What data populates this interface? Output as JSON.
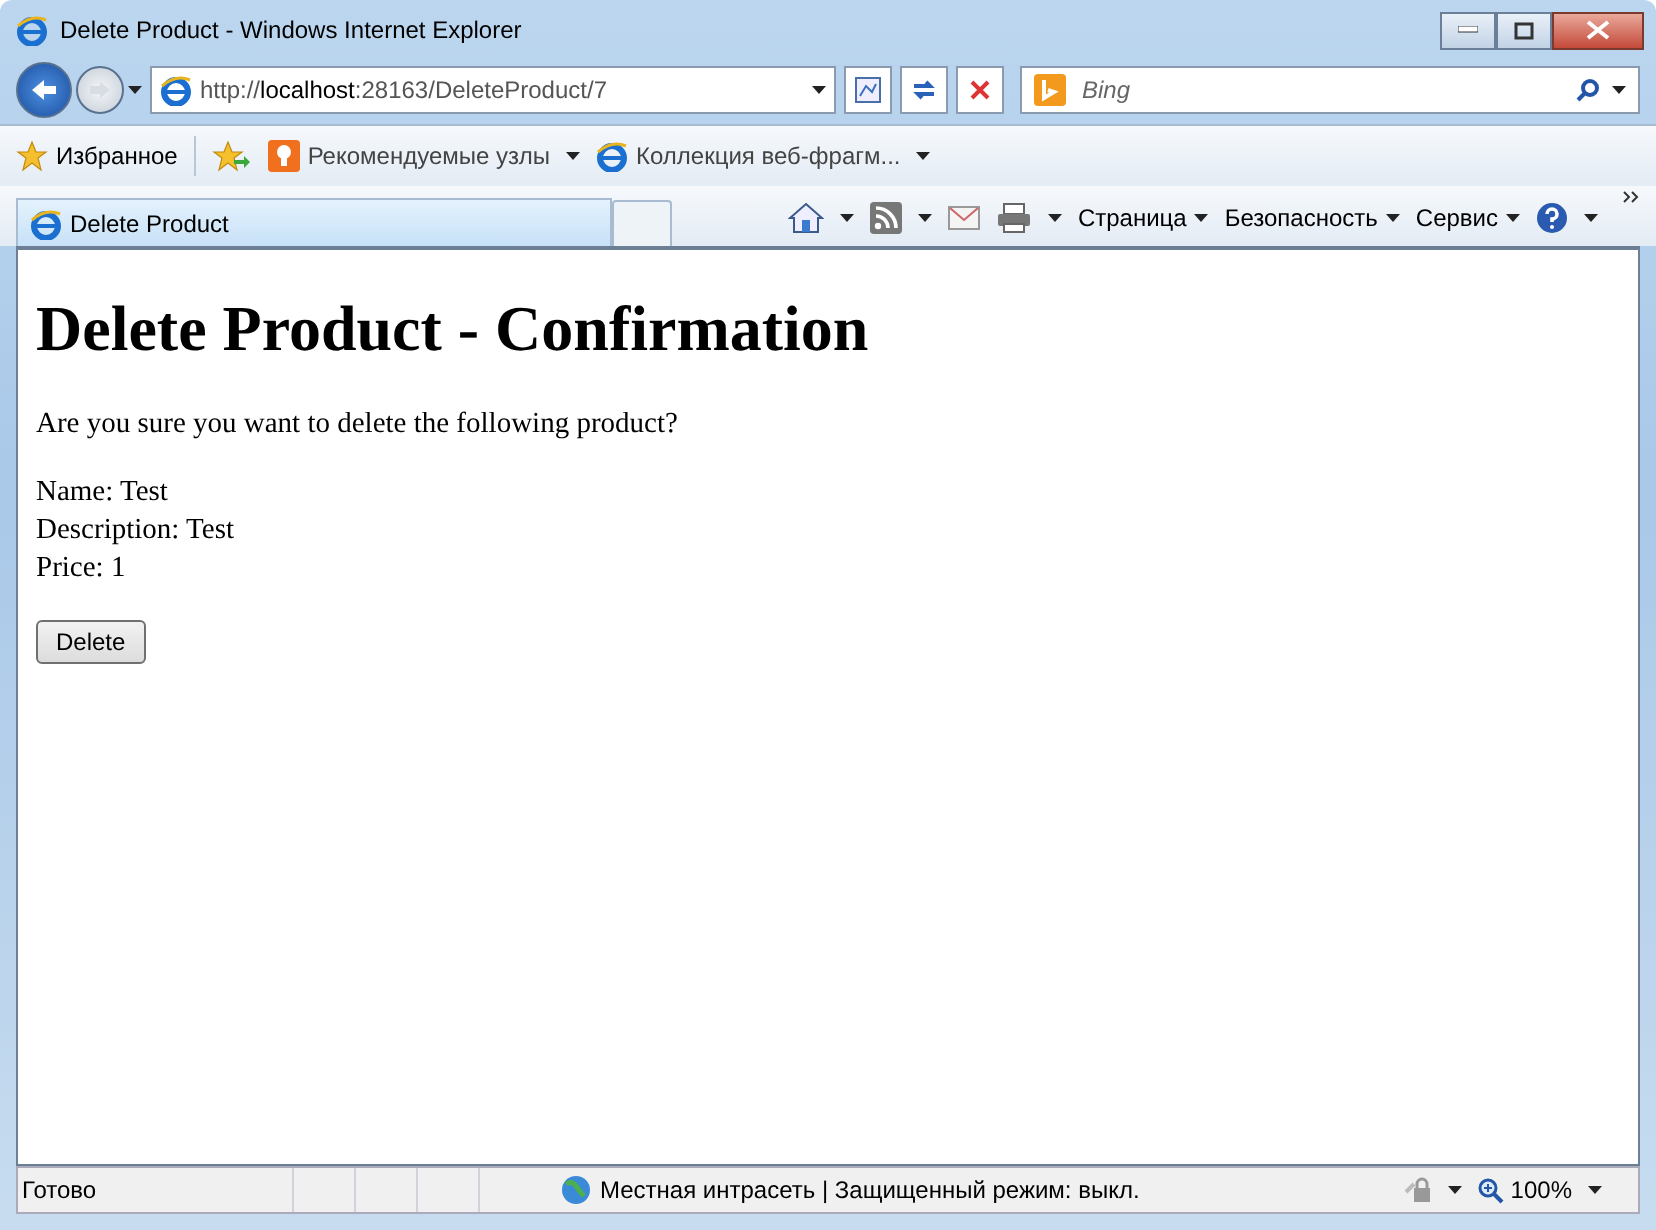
{
  "window": {
    "title": "Delete Product - Windows Internet Explorer"
  },
  "address_bar": {
    "url": "http://**localhost**:28163/DeleteProduct/7"
  },
  "search": {
    "placeholder": "Bing"
  },
  "favorites_bar": {
    "favorites": "Избранное",
    "links": [
      "Рекомендуемые узлы",
      "Коллекция веб-фрагм..."
    ]
  },
  "tabs": [
    {
      "label": "Delete Product",
      "selected": true
    }
  ],
  "command_bar": {
    "menus": [
      "Страница",
      "Безопасность",
      "Сервис"
    ]
  },
  "page": {
    "heading": "Delete Product - Confirmation",
    "question": "Are you sure you want to delete the following product?",
    "fields": [
      "Name: Test",
      "Description: Test",
      "Price: 1"
    ],
    "button": "Delete"
  },
  "status_bar": {
    "status": "Готово",
    "zone": "Местная интрасеть | Защищенный режим: выкл.",
    "zoom": "100%"
  }
}
